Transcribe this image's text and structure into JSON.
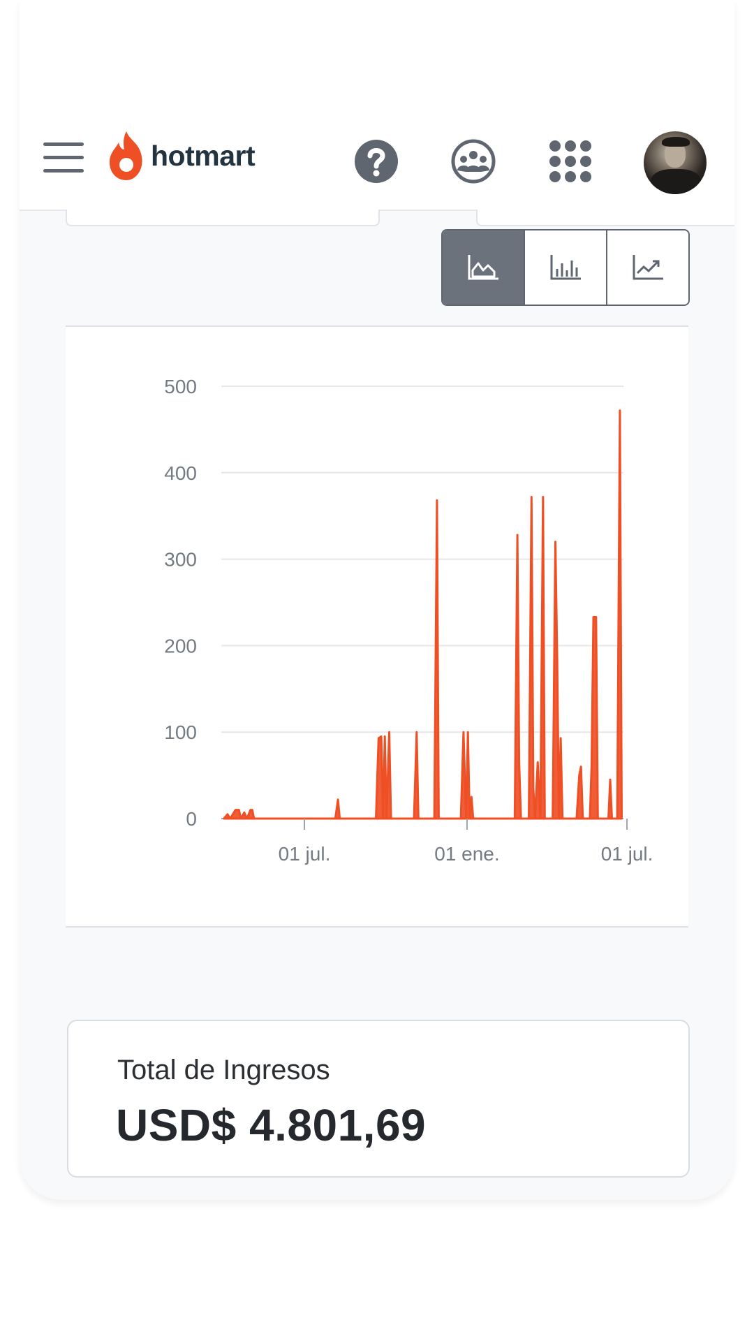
{
  "header": {
    "brand_name": "hotmart",
    "icons": [
      "menu-icon",
      "help-icon",
      "community-icon",
      "apps-grid-icon",
      "avatar"
    ]
  },
  "chart_toggle": {
    "options": [
      "area-chart-icon",
      "bar-chart-icon",
      "line-chart-icon"
    ],
    "active_index": 0
  },
  "colors": {
    "accent": "#ef4f25",
    "toggle_active": "#6b727b",
    "text_dark": "#25292d"
  },
  "chart_data": {
    "type": "area",
    "x_tick_labels": [
      "01 jul.",
      "01 ene.",
      "01 jul."
    ],
    "y_tick_labels": [
      "0",
      "100",
      "200",
      "300",
      "400",
      "500"
    ],
    "ylim": [
      0,
      500
    ],
    "grid": true,
    "series": [
      {
        "color": "#ef4f25",
        "points": [
          [
            "2022-04-01",
            0
          ],
          [
            "2022-04-05",
            5
          ],
          [
            "2022-04-08",
            0
          ],
          [
            "2022-04-14",
            10
          ],
          [
            "2022-04-18",
            10
          ],
          [
            "2022-04-20",
            0
          ],
          [
            "2022-04-24",
            7
          ],
          [
            "2022-04-27",
            0
          ],
          [
            "2022-05-01",
            10
          ],
          [
            "2022-05-03",
            10
          ],
          [
            "2022-05-05",
            0
          ],
          [
            "2022-08-05",
            0
          ],
          [
            "2022-08-08",
            22
          ],
          [
            "2022-08-10",
            0
          ],
          [
            "2022-09-20",
            0
          ],
          [
            "2022-09-23",
            93
          ],
          [
            "2022-09-26",
            95
          ],
          [
            "2022-09-28",
            0
          ],
          [
            "2022-09-30",
            95
          ],
          [
            "2022-10-02",
            0
          ],
          [
            "2022-10-05",
            100
          ],
          [
            "2022-10-07",
            0
          ],
          [
            "2022-11-02",
            0
          ],
          [
            "2022-11-05",
            100
          ],
          [
            "2022-11-07",
            0
          ],
          [
            "2022-11-25",
            0
          ],
          [
            "2022-11-28",
            368
          ],
          [
            "2022-11-30",
            0
          ],
          [
            "2022-12-25",
            0
          ],
          [
            "2022-12-28",
            100
          ],
          [
            "2022-12-31",
            0
          ],
          [
            "2023-01-02",
            100
          ],
          [
            "2023-01-04",
            0
          ],
          [
            "2023-01-06",
            25
          ],
          [
            "2023-01-08",
            0
          ],
          [
            "2023-02-24",
            0
          ],
          [
            "2023-02-27",
            328
          ],
          [
            "2023-03-01",
            65
          ],
          [
            "2023-03-03",
            0
          ],
          [
            "2023-03-12",
            0
          ],
          [
            "2023-03-15",
            372
          ],
          [
            "2023-03-17",
            35
          ],
          [
            "2023-03-19",
            0
          ],
          [
            "2023-03-22",
            65
          ],
          [
            "2023-03-25",
            0
          ],
          [
            "2023-03-28",
            372
          ],
          [
            "2023-03-30",
            0
          ],
          [
            "2023-04-08",
            0
          ],
          [
            "2023-04-11",
            320
          ],
          [
            "2023-04-13",
            185
          ],
          [
            "2023-04-15",
            0
          ],
          [
            "2023-04-17",
            93
          ],
          [
            "2023-04-19",
            0
          ],
          [
            "2023-05-05",
            0
          ],
          [
            "2023-05-08",
            50
          ],
          [
            "2023-05-10",
            60
          ],
          [
            "2023-05-12",
            0
          ],
          [
            "2023-05-20",
            0
          ],
          [
            "2023-05-22",
            62
          ],
          [
            "2023-05-24",
            233
          ],
          [
            "2023-05-27",
            233
          ],
          [
            "2023-05-29",
            0
          ],
          [
            "2023-06-10",
            0
          ],
          [
            "2023-06-12",
            45
          ],
          [
            "2023-06-14",
            0
          ],
          [
            "2023-06-20",
            0
          ],
          [
            "2023-06-23",
            472
          ],
          [
            "2023-06-25",
            0
          ]
        ]
      }
    ]
  },
  "total": {
    "label": "Total de Ingresos",
    "value": "USD$ 4.801,69"
  }
}
